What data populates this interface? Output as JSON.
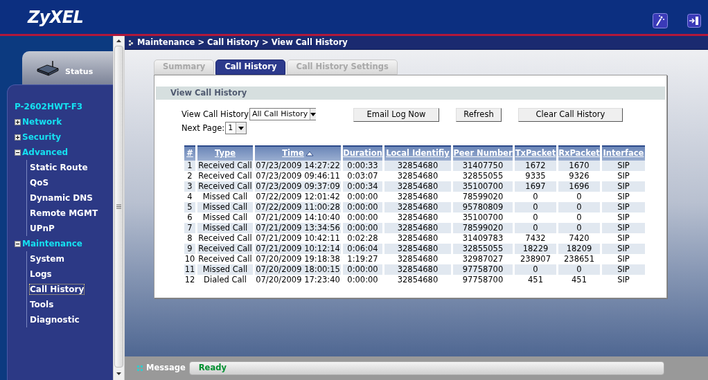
{
  "header": {
    "logo": "ZyXEL"
  },
  "sidebar": {
    "status_tab": "Status",
    "device": "P-2602HWT-F3",
    "items": [
      {
        "label": "Network",
        "expanded": false
      },
      {
        "label": "Security",
        "expanded": false
      },
      {
        "label": "Advanced",
        "expanded": true,
        "children": [
          {
            "label": "Static Route",
            "selected": false
          },
          {
            "label": "QoS",
            "selected": false
          },
          {
            "label": "Dynamic DNS",
            "selected": false
          },
          {
            "label": "Remote MGMT",
            "selected": false
          },
          {
            "label": "UPnP",
            "selected": false
          }
        ]
      },
      {
        "label": "Maintenance",
        "expanded": true,
        "children": [
          {
            "label": "System",
            "selected": false
          },
          {
            "label": "Logs",
            "selected": false
          },
          {
            "label": "Call History",
            "selected": true
          },
          {
            "label": "Tools",
            "selected": false
          },
          {
            "label": "Diagnostic",
            "selected": false
          }
        ]
      }
    ]
  },
  "breadcrumb": "Maintenance > Call History > View Call History",
  "tabs": [
    {
      "label": "Summary",
      "selected": false
    },
    {
      "label": "Call History",
      "selected": true
    },
    {
      "label": "Call History Settings",
      "selected": false
    }
  ],
  "section_title": "View Call History",
  "filters": [
    {
      "label": "View Call History",
      "value": "All Call History"
    },
    {
      "label": "Next Page:",
      "value": "1"
    }
  ],
  "buttons": [
    "Email Log Now",
    "Refresh",
    "Clear Call History"
  ],
  "table": {
    "columns": [
      {
        "label": "#",
        "sorted": false
      },
      {
        "label": "Type",
        "sorted": false
      },
      {
        "label": "Time",
        "sorted": true
      },
      {
        "label": "Duration",
        "sorted": false
      },
      {
        "label": "Local Identifiy",
        "sorted": false
      },
      {
        "label": "Peer Number",
        "sorted": false
      },
      {
        "label": "TxPacket",
        "sorted": false
      },
      {
        "label": "RxPacket",
        "sorted": false
      },
      {
        "label": "Interface",
        "sorted": false
      }
    ],
    "rows": [
      [
        "1",
        "Received Call",
        "07/23/2009 14:27:22",
        "0:00:33",
        "32854680",
        "31407750",
        "1672",
        "1670",
        "SIP"
      ],
      [
        "2",
        "Received Call",
        "07/23/2009 09:46:11",
        "0:03:07",
        "32854680",
        "32855055",
        "9335",
        "9326",
        "SIP"
      ],
      [
        "3",
        "Received Call",
        "07/23/2009 09:37:09",
        "0:00:34",
        "32854680",
        "35100700",
        "1697",
        "1696",
        "SIP"
      ],
      [
        "4",
        "Missed Call",
        "07/22/2009 12:01:42",
        "0:00:00",
        "32854680",
        "78599020",
        "0",
        "0",
        "SIP"
      ],
      [
        "5",
        "Missed Call",
        "07/22/2009 11:00:28",
        "0:00:00",
        "32854680",
        "95780809",
        "0",
        "0",
        "SIP"
      ],
      [
        "6",
        "Missed Call",
        "07/21/2009 14:10:40",
        "0:00:00",
        "32854680",
        "35100700",
        "0",
        "0",
        "SIP"
      ],
      [
        "7",
        "Missed Call",
        "07/21/2009 13:34:56",
        "0:00:00",
        "32854680",
        "78599020",
        "0",
        "0",
        "SIP"
      ],
      [
        "8",
        "Received Call",
        "07/21/2009 10:42:11",
        "0:02:28",
        "32854680",
        "31409783",
        "7432",
        "7420",
        "SIP"
      ],
      [
        "9",
        "Received Call",
        "07/21/2009 10:12:14",
        "0:06:04",
        "32854680",
        "32855055",
        "18229",
        "18209",
        "SIP"
      ],
      [
        "10",
        "Received Call",
        "07/20/2009 19:18:38",
        "1:19:27",
        "32854680",
        "32987027",
        "238907",
        "238651",
        "SIP"
      ],
      [
        "11",
        "Missed Call",
        "07/20/2009 18:00:15",
        "0:00:00",
        "32854680",
        "97758700",
        "0",
        "0",
        "SIP"
      ],
      [
        "12",
        "Dialed Call",
        "07/20/2009 17:23:40",
        "0:00:00",
        "32854680",
        "97758700",
        "451",
        "451",
        "SIP"
      ]
    ]
  },
  "status_bar": {
    "label": "Message",
    "text": "Ready"
  }
}
